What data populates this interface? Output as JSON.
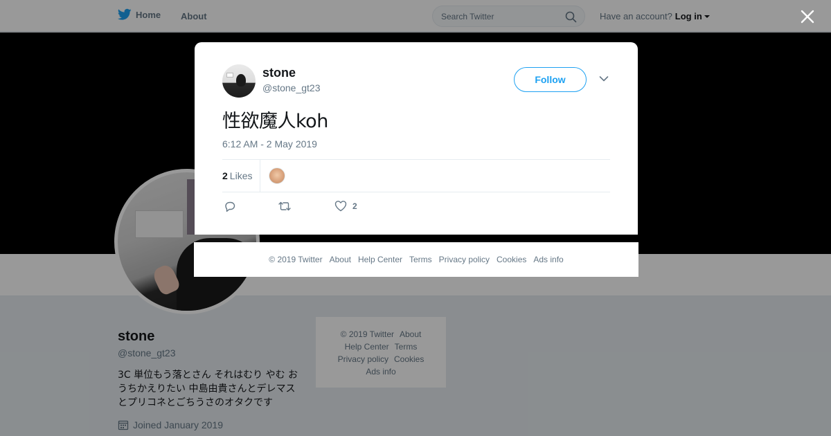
{
  "nav": {
    "home_label": "Home",
    "about_label": "About"
  },
  "search": {
    "placeholder": "Search Twitter"
  },
  "account": {
    "prompt": "Have an account?",
    "login_label": "Log in"
  },
  "profile": {
    "name": "stone",
    "handle": "@stone_gt23",
    "bio": "3C 単位もう落とさん それはむり やむ おうちかえりたい 中島由貴さんとデレマスとプリコネとごちうさのオタクです",
    "joined": "Joined January 2019"
  },
  "side_footer": {
    "copyright": "© 2019 Twitter",
    "about": "About",
    "help": "Help Center",
    "terms": "Terms",
    "privacy": "Privacy policy",
    "cookies": "Cookies",
    "ads": "Ads info"
  },
  "tweet": {
    "name": "stone",
    "handle": "@stone_gt23",
    "follow_label": "Follow",
    "text": "性欲魔人koh",
    "time": "6:12 AM - 2 May 2019",
    "likes_count": "2",
    "likes_label": "Likes",
    "like_action_count": "2"
  },
  "modal_footer": {
    "copyright": "© 2019 Twitter",
    "about": "About",
    "help": "Help Center",
    "terms": "Terms",
    "privacy": "Privacy policy",
    "cookies": "Cookies",
    "ads": "Ads info"
  },
  "colors": {
    "brand": "#1da1f2",
    "muted": "#657786",
    "text": "#14171a"
  }
}
